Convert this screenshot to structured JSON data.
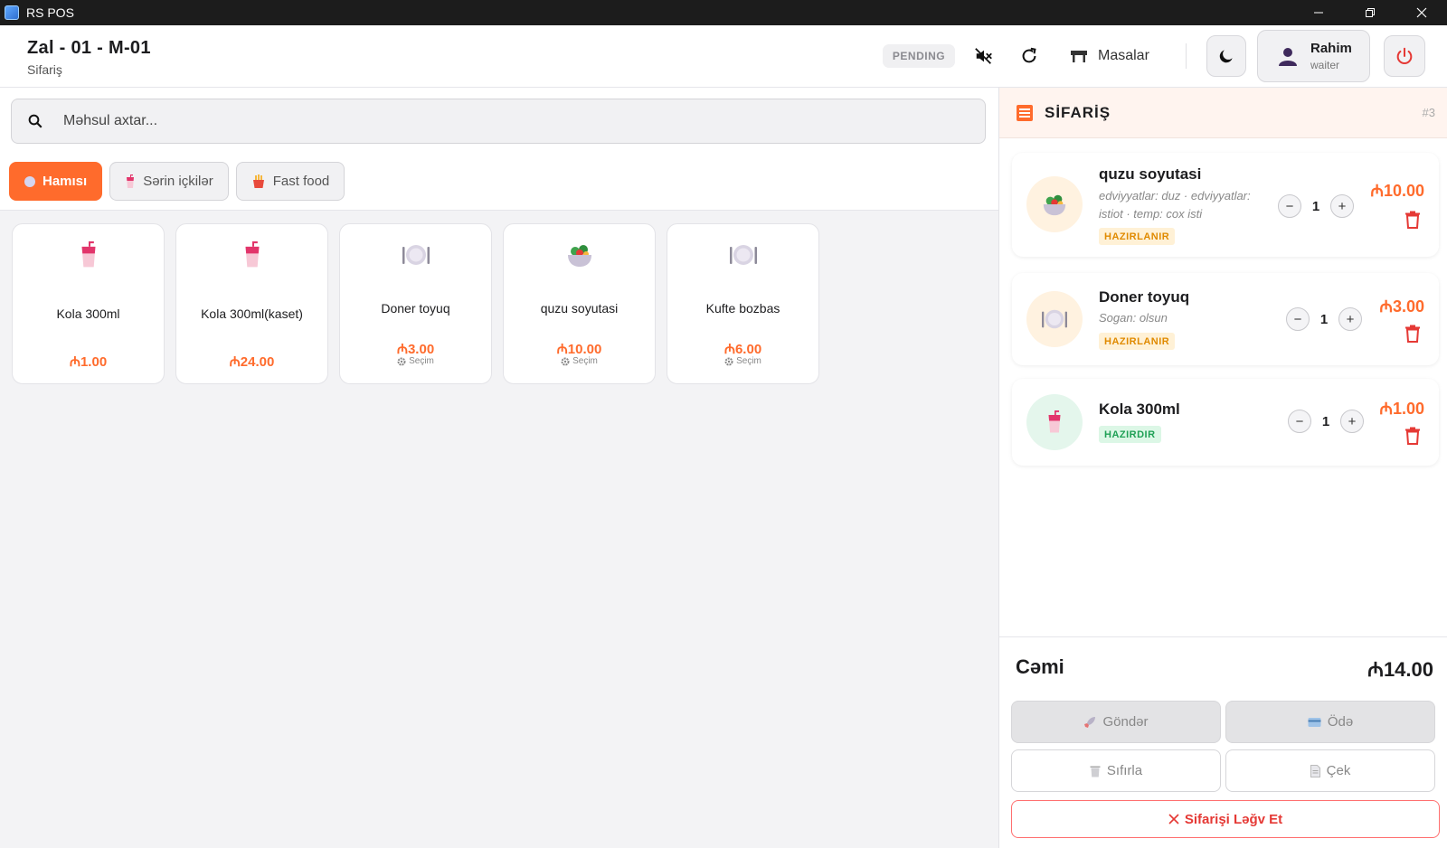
{
  "window": {
    "title": "RS POS"
  },
  "header": {
    "title": "Zal - 01 - M-01",
    "subtitle": "Sifariş",
    "status_badge": "PENDING",
    "tables_label": "Masalar",
    "user": {
      "name": "Rahim",
      "role": "waiter"
    }
  },
  "search": {
    "placeholder": "Məhsul axtar..."
  },
  "categories": [
    {
      "label": "Hamısı",
      "active": true
    },
    {
      "label": "Sərin içkilər",
      "active": false
    },
    {
      "label": "Fast food",
      "active": false
    }
  ],
  "products": [
    {
      "name": "Kola 300ml",
      "price": "₼1.00",
      "icon": "drink-cup-icon"
    },
    {
      "name": "Kola 300ml(kaset)",
      "price": "₼24.00",
      "icon": "drink-cup-icon"
    },
    {
      "name": "Doner toyuq",
      "price": "₼3.00",
      "option": "Seçim",
      "icon": "plate-icon"
    },
    {
      "name": "quzu soyutasi",
      "price": "₼10.00",
      "option": "Seçim",
      "icon": "salad-bowl-icon"
    },
    {
      "name": "Kufte bozbas",
      "price": "₼6.00",
      "option": "Seçim",
      "icon": "plate-icon"
    }
  ],
  "order": {
    "title": "SİFARİŞ",
    "number": "#3",
    "items": [
      {
        "name": "quzu soyutasi",
        "note": "edviyyatlar: duz · edviyyatlar: istiot · temp: cox isti",
        "status": "HAZIRLANIR",
        "qty": "1",
        "price": "₼10.00"
      },
      {
        "name": "Doner toyuq",
        "note": "Sogan: olsun",
        "status": "HAZIRLANIR",
        "qty": "1",
        "price": "₼3.00"
      },
      {
        "name": "Kola 300ml",
        "note": "",
        "status": "HAZIRDIR",
        "qty": "1",
        "price": "₼1.00"
      }
    ],
    "total_label": "Cəmi",
    "total_value": "₼14.00",
    "actions": {
      "send": "Göndər",
      "pay": "Ödə",
      "reset": "Sıfırla",
      "receipt": "Çek",
      "cancel": "Sifarişi Ləğv Et"
    }
  },
  "colors": {
    "accent": "#ff6b2c",
    "danger": "#e53935",
    "preparing": "#e08a00",
    "ready": "#1fa055"
  }
}
